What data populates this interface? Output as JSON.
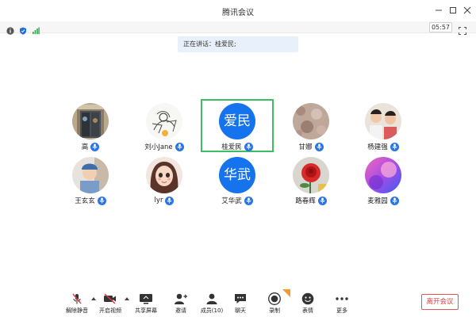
{
  "window": {
    "title": "腾讯会议"
  },
  "infobar": {
    "timer": "05:57"
  },
  "speaking": {
    "label": "正在讲话：桂爱民;"
  },
  "participants": [
    {
      "name": "高",
      "avatar": "photo-door"
    },
    {
      "name": "刘小Jane",
      "avatar": "photo-sketch"
    },
    {
      "name": "桂爱民",
      "avatar_text": "爱民",
      "active": true
    },
    {
      "name": "甘娜",
      "avatar": "photo-texture"
    },
    {
      "name": "杨建强",
      "avatar": "photo-kids"
    },
    {
      "name": "王玄玄",
      "avatar": "photo-child-hat"
    },
    {
      "name": "lyr",
      "avatar": "photo-cartoon-girl"
    },
    {
      "name": "艾华武",
      "avatar_text": "华武"
    },
    {
      "name": "路春辉",
      "avatar": "photo-rose"
    },
    {
      "name": "麦雅园",
      "avatar": "photo-abstract"
    }
  ],
  "toolbar": {
    "unmute": "解除静音",
    "start_video": "开启视频",
    "share_screen": "共享屏幕",
    "invite": "邀请",
    "members": "成员(10)",
    "chat": "聊天",
    "record": "录制",
    "reactions": "表情",
    "more": "更多",
    "leave": "离开会议"
  },
  "colors": {
    "accent": "#1673ee",
    "active_border": "#3cbf63",
    "danger": "#e03e3e"
  }
}
